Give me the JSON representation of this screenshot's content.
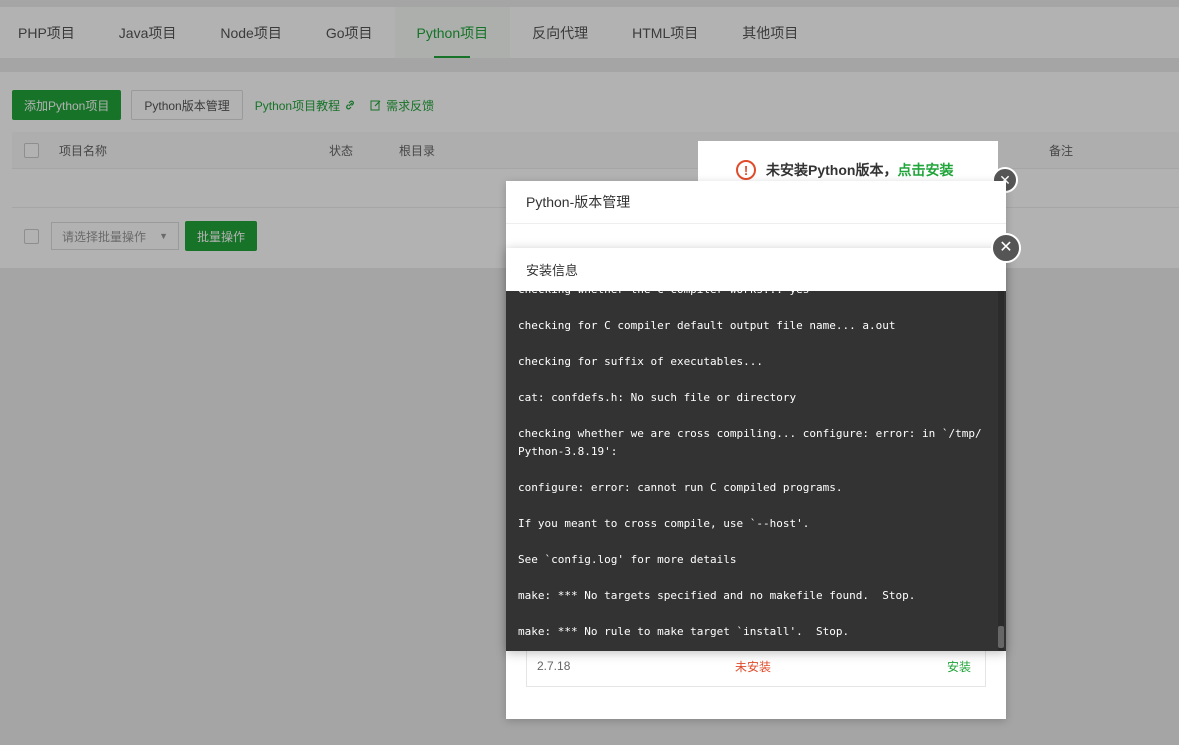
{
  "tabs": [
    {
      "label": "PHP项目",
      "active": false
    },
    {
      "label": "Java项目",
      "active": false
    },
    {
      "label": "Node项目",
      "active": false
    },
    {
      "label": "Go项目",
      "active": false
    },
    {
      "label": "Python项目",
      "active": true
    },
    {
      "label": "反向代理",
      "active": false
    },
    {
      "label": "HTML项目",
      "active": false
    },
    {
      "label": "其他项目",
      "active": false
    }
  ],
  "toolbar": {
    "add_button": "添加Python项目",
    "version_button": "Python版本管理",
    "tutorial_link": "Python项目教程",
    "feedback_link": "需求反馈"
  },
  "table": {
    "headers": [
      "项目名称",
      "状态",
      "根目录",
      "备注"
    ]
  },
  "batch": {
    "select_placeholder": "请选择批量操作",
    "button": "批量操作"
  },
  "notice": {
    "text": "未安装Python版本，",
    "link": "点击安装"
  },
  "version_dialog": {
    "title": "Python-版本管理",
    "row": {
      "version": "2.7.18",
      "status": "未安装",
      "action": "安装"
    }
  },
  "install_dialog": {
    "title": "安装信息",
    "log_lines": [
      "checking whether the C compiler works... yes",
      "checking for C compiler default output file name... a.out",
      "checking for suffix of executables...",
      "cat: confdefs.h: No such file or directory",
      "checking whether we are cross compiling... configure: error: in `/tmp/Python-3.8.19':",
      "configure: error: cannot run C compiled programs.",
      "If you meant to cross compile, use `--host'.",
      "See `config.log' for more details",
      "make: *** No targets specified and no makefile found.  Stop.",
      "make: *** No rule to make target `install'.  Stop."
    ]
  },
  "colors": {
    "accent": "#20a53a",
    "error": "#e04c2b",
    "console_bg": "#333333"
  }
}
